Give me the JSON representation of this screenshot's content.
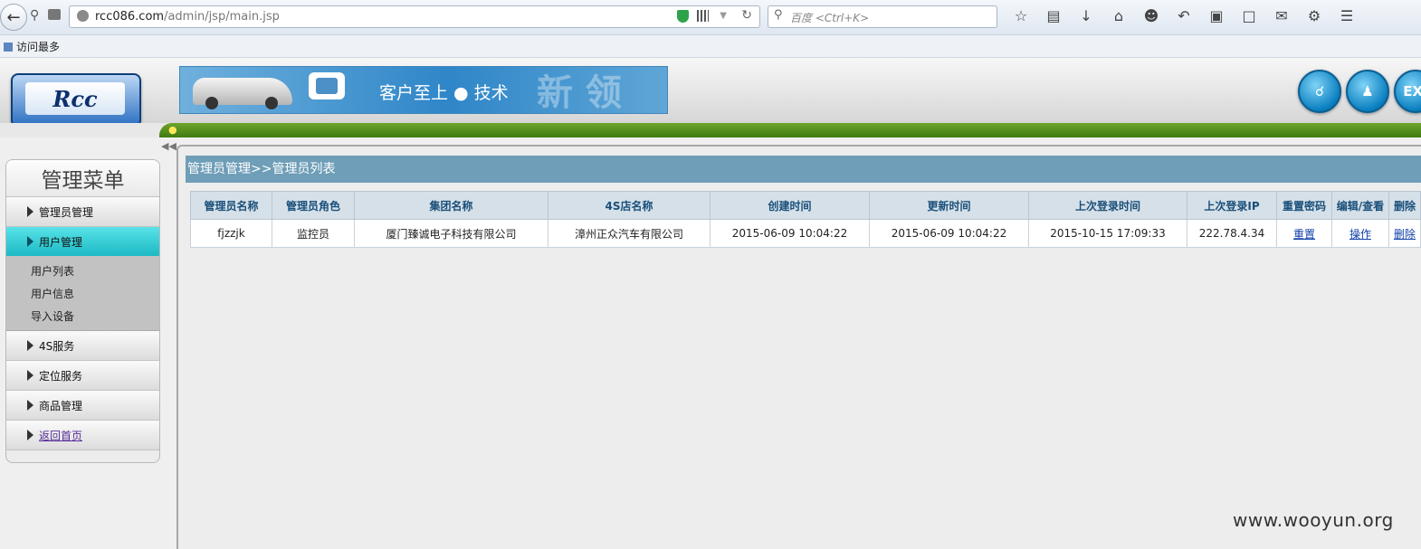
{
  "browser": {
    "url_host": "rcc086.com",
    "url_path": "/admin/jsp/main.jsp",
    "search_placeholder": "百度 <Ctrl+K>",
    "bookmark": "访问最多"
  },
  "header": {
    "logo_text": "Rcc",
    "slogan": "客户至上 ● 技术",
    "slogan_ghost": "新 领",
    "exit_label": "EXI"
  },
  "sidebar": {
    "title": "管理菜单",
    "items": [
      {
        "label": "管理员管理"
      },
      {
        "label": "用户管理"
      },
      {
        "label": "4S服务"
      },
      {
        "label": "定位服务"
      },
      {
        "label": "商品管理"
      },
      {
        "label": "返回首页"
      }
    ],
    "subitems": [
      "用户列表",
      "用户信息",
      "导入设备"
    ]
  },
  "main": {
    "breadcrumb": "管理员管理>>管理员列表",
    "columns": [
      "管理员名称",
      "管理员角色",
      "集团名称",
      "4S店名称",
      "创建时间",
      "更新时间",
      "上次登录时间",
      "上次登录IP",
      "重置密码",
      "编辑/查看",
      "删除"
    ],
    "rows": [
      {
        "name": "fjzzjk",
        "role": "监控员",
        "group": "厦门臻诚电子科技有限公司",
        "store": "漳州正众汽车有限公司",
        "created": "2015-06-09 10:04:22",
        "updated": "2015-06-09 10:04:22",
        "last_login": "2015-10-15 17:09:33",
        "last_ip": "222.78.4.34",
        "reset": "重置",
        "edit": "操作",
        "delete": "删除"
      }
    ]
  },
  "watermark": "www.wooyun.org"
}
